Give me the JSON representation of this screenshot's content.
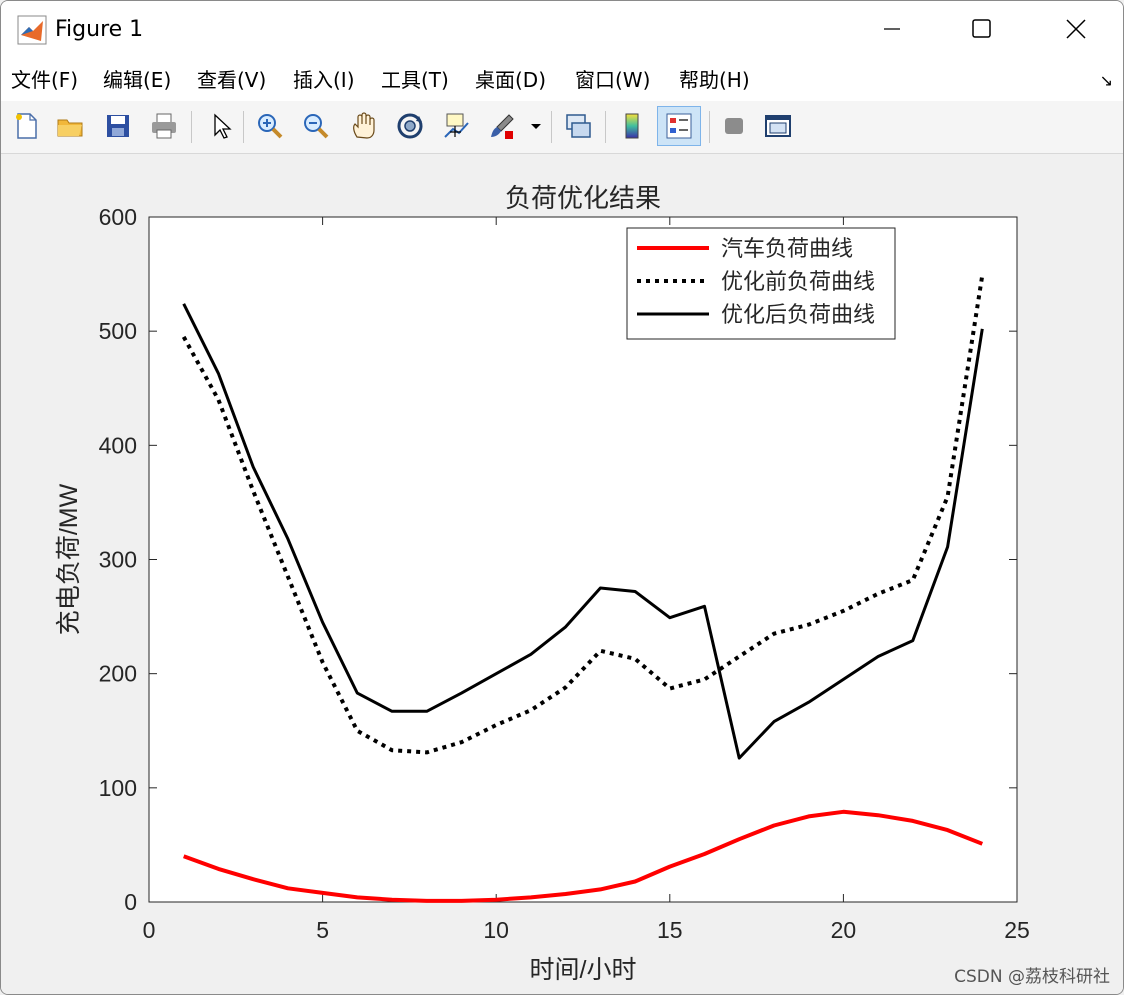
{
  "window": {
    "title": "Figure 1",
    "controls": {
      "minimize": "minimize",
      "maximize": "maximize",
      "close": "close"
    }
  },
  "menu": {
    "items": [
      "文件(F)",
      "编辑(E)",
      "查看(V)",
      "插入(I)",
      "工具(T)",
      "桌面(D)",
      "窗口(W)",
      "帮助(H)"
    ]
  },
  "toolbar": {
    "icons": [
      "new-file-icon",
      "open-folder-icon",
      "save-icon",
      "print-icon",
      "pointer-icon",
      "zoom-in-icon",
      "zoom-out-icon",
      "pan-hand-icon",
      "rotate-3d-icon",
      "data-cursor-icon",
      "brush-icon",
      "brush-dropdown-icon",
      "link-plot-icon",
      "colorbar-icon",
      "legend-icon",
      "hide-tools-icon",
      "dock-figure-icon"
    ]
  },
  "chart_data": {
    "type": "line",
    "title": "负荷优化结果",
    "xlabel": "时间/小时",
    "ylabel": "充电负荷/MW",
    "xlim": [
      0,
      25
    ],
    "ylim": [
      0,
      600
    ],
    "xticks": [
      0,
      5,
      10,
      15,
      20,
      25
    ],
    "yticks": [
      0,
      100,
      200,
      300,
      400,
      500,
      600
    ],
    "legend_position": "top-right",
    "grid": false,
    "x": [
      1,
      2,
      3,
      4,
      5,
      6,
      7,
      8,
      9,
      10,
      11,
      12,
      13,
      14,
      15,
      16,
      17,
      18,
      19,
      20,
      21,
      22,
      23,
      24
    ],
    "series": [
      {
        "name": "汽车负荷曲线",
        "color": "#ff0000",
        "style": "solid-thick",
        "values": [
          40,
          29,
          20,
          12,
          8,
          4,
          2,
          1,
          1,
          2,
          4,
          7,
          11,
          18,
          31,
          42,
          55,
          67,
          75,
          79,
          76,
          71,
          63,
          51
        ]
      },
      {
        "name": "优化前负荷曲线",
        "color": "#000000",
        "style": "dotted",
        "values": [
          495,
          440,
          360,
          285,
          210,
          150,
          133,
          131,
          140,
          155,
          168,
          188,
          220,
          213,
          187,
          195,
          215,
          235,
          243,
          255,
          270,
          282,
          355,
          549
        ]
      },
      {
        "name": "优化后负荷曲线",
        "color": "#000000",
        "style": "solid",
        "values": [
          524,
          463,
          381,
          318,
          245,
          183,
          167,
          167,
          183,
          200,
          217,
          241,
          275,
          272,
          249,
          259,
          126,
          158,
          175,
          195,
          215,
          229,
          311,
          502
        ]
      }
    ]
  },
  "watermark": "CSDN @荔枝科研社"
}
